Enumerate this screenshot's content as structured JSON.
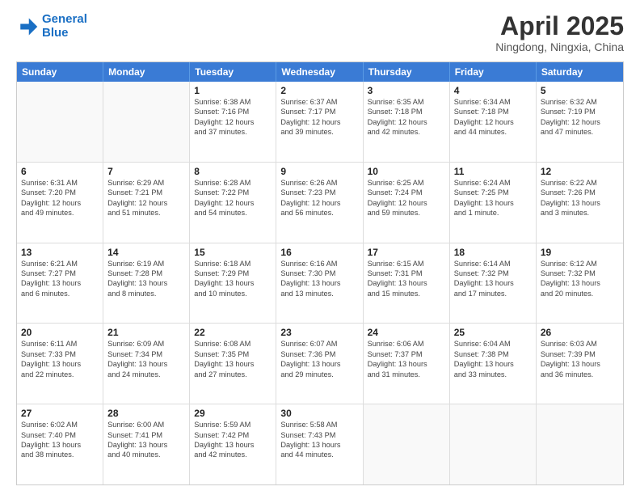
{
  "logo": {
    "line1": "General",
    "line2": "Blue"
  },
  "title": "April 2025",
  "subtitle": "Ningdong, Ningxia, China",
  "header_days": [
    "Sunday",
    "Monday",
    "Tuesday",
    "Wednesday",
    "Thursday",
    "Friday",
    "Saturday"
  ],
  "rows": [
    [
      {
        "day": "",
        "lines": []
      },
      {
        "day": "",
        "lines": []
      },
      {
        "day": "1",
        "lines": [
          "Sunrise: 6:38 AM",
          "Sunset: 7:16 PM",
          "Daylight: 12 hours",
          "and 37 minutes."
        ]
      },
      {
        "day": "2",
        "lines": [
          "Sunrise: 6:37 AM",
          "Sunset: 7:17 PM",
          "Daylight: 12 hours",
          "and 39 minutes."
        ]
      },
      {
        "day": "3",
        "lines": [
          "Sunrise: 6:35 AM",
          "Sunset: 7:18 PM",
          "Daylight: 12 hours",
          "and 42 minutes."
        ]
      },
      {
        "day": "4",
        "lines": [
          "Sunrise: 6:34 AM",
          "Sunset: 7:18 PM",
          "Daylight: 12 hours",
          "and 44 minutes."
        ]
      },
      {
        "day": "5",
        "lines": [
          "Sunrise: 6:32 AM",
          "Sunset: 7:19 PM",
          "Daylight: 12 hours",
          "and 47 minutes."
        ]
      }
    ],
    [
      {
        "day": "6",
        "lines": [
          "Sunrise: 6:31 AM",
          "Sunset: 7:20 PM",
          "Daylight: 12 hours",
          "and 49 minutes."
        ]
      },
      {
        "day": "7",
        "lines": [
          "Sunrise: 6:29 AM",
          "Sunset: 7:21 PM",
          "Daylight: 12 hours",
          "and 51 minutes."
        ]
      },
      {
        "day": "8",
        "lines": [
          "Sunrise: 6:28 AM",
          "Sunset: 7:22 PM",
          "Daylight: 12 hours",
          "and 54 minutes."
        ]
      },
      {
        "day": "9",
        "lines": [
          "Sunrise: 6:26 AM",
          "Sunset: 7:23 PM",
          "Daylight: 12 hours",
          "and 56 minutes."
        ]
      },
      {
        "day": "10",
        "lines": [
          "Sunrise: 6:25 AM",
          "Sunset: 7:24 PM",
          "Daylight: 12 hours",
          "and 59 minutes."
        ]
      },
      {
        "day": "11",
        "lines": [
          "Sunrise: 6:24 AM",
          "Sunset: 7:25 PM",
          "Daylight: 13 hours",
          "and 1 minute."
        ]
      },
      {
        "day": "12",
        "lines": [
          "Sunrise: 6:22 AM",
          "Sunset: 7:26 PM",
          "Daylight: 13 hours",
          "and 3 minutes."
        ]
      }
    ],
    [
      {
        "day": "13",
        "lines": [
          "Sunrise: 6:21 AM",
          "Sunset: 7:27 PM",
          "Daylight: 13 hours",
          "and 6 minutes."
        ]
      },
      {
        "day": "14",
        "lines": [
          "Sunrise: 6:19 AM",
          "Sunset: 7:28 PM",
          "Daylight: 13 hours",
          "and 8 minutes."
        ]
      },
      {
        "day": "15",
        "lines": [
          "Sunrise: 6:18 AM",
          "Sunset: 7:29 PM",
          "Daylight: 13 hours",
          "and 10 minutes."
        ]
      },
      {
        "day": "16",
        "lines": [
          "Sunrise: 6:16 AM",
          "Sunset: 7:30 PM",
          "Daylight: 13 hours",
          "and 13 minutes."
        ]
      },
      {
        "day": "17",
        "lines": [
          "Sunrise: 6:15 AM",
          "Sunset: 7:31 PM",
          "Daylight: 13 hours",
          "and 15 minutes."
        ]
      },
      {
        "day": "18",
        "lines": [
          "Sunrise: 6:14 AM",
          "Sunset: 7:32 PM",
          "Daylight: 13 hours",
          "and 17 minutes."
        ]
      },
      {
        "day": "19",
        "lines": [
          "Sunrise: 6:12 AM",
          "Sunset: 7:32 PM",
          "Daylight: 13 hours",
          "and 20 minutes."
        ]
      }
    ],
    [
      {
        "day": "20",
        "lines": [
          "Sunrise: 6:11 AM",
          "Sunset: 7:33 PM",
          "Daylight: 13 hours",
          "and 22 minutes."
        ]
      },
      {
        "day": "21",
        "lines": [
          "Sunrise: 6:09 AM",
          "Sunset: 7:34 PM",
          "Daylight: 13 hours",
          "and 24 minutes."
        ]
      },
      {
        "day": "22",
        "lines": [
          "Sunrise: 6:08 AM",
          "Sunset: 7:35 PM",
          "Daylight: 13 hours",
          "and 27 minutes."
        ]
      },
      {
        "day": "23",
        "lines": [
          "Sunrise: 6:07 AM",
          "Sunset: 7:36 PM",
          "Daylight: 13 hours",
          "and 29 minutes."
        ]
      },
      {
        "day": "24",
        "lines": [
          "Sunrise: 6:06 AM",
          "Sunset: 7:37 PM",
          "Daylight: 13 hours",
          "and 31 minutes."
        ]
      },
      {
        "day": "25",
        "lines": [
          "Sunrise: 6:04 AM",
          "Sunset: 7:38 PM",
          "Daylight: 13 hours",
          "and 33 minutes."
        ]
      },
      {
        "day": "26",
        "lines": [
          "Sunrise: 6:03 AM",
          "Sunset: 7:39 PM",
          "Daylight: 13 hours",
          "and 36 minutes."
        ]
      }
    ],
    [
      {
        "day": "27",
        "lines": [
          "Sunrise: 6:02 AM",
          "Sunset: 7:40 PM",
          "Daylight: 13 hours",
          "and 38 minutes."
        ]
      },
      {
        "day": "28",
        "lines": [
          "Sunrise: 6:00 AM",
          "Sunset: 7:41 PM",
          "Daylight: 13 hours",
          "and 40 minutes."
        ]
      },
      {
        "day": "29",
        "lines": [
          "Sunrise: 5:59 AM",
          "Sunset: 7:42 PM",
          "Daylight: 13 hours",
          "and 42 minutes."
        ]
      },
      {
        "day": "30",
        "lines": [
          "Sunrise: 5:58 AM",
          "Sunset: 7:43 PM",
          "Daylight: 13 hours",
          "and 44 minutes."
        ]
      },
      {
        "day": "",
        "lines": []
      },
      {
        "day": "",
        "lines": []
      },
      {
        "day": "",
        "lines": []
      }
    ]
  ]
}
